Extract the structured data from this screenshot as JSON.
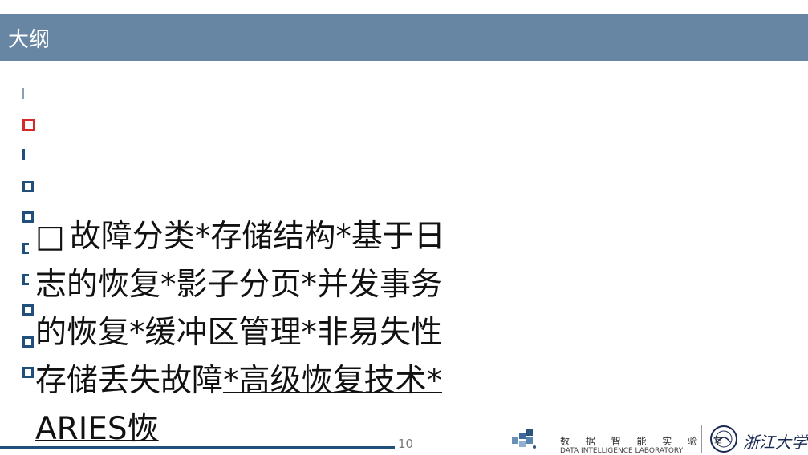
{
  "slide": {
    "title": "大纲",
    "lead_symbol": "□",
    "body_lines": [
      "故障分类*存储结构*基",
      "于日志的恢复*影子分页*",
      "并发事务的恢复*缓冲区管",
      "理*非易失性存储丢失故障",
      "*高级恢复技术*ARIES恢"
    ],
    "page_number": "10",
    "footer": {
      "lab_name_cn": "数 据 智 能 实 验 室",
      "lab_name_en": "DATA INTELLIGENCE LABORATORY",
      "university_name": "浙江大学"
    },
    "colors": {
      "title_bar": "#6786a3",
      "bullet_accent": "#d62a2a",
      "bullet": "#1f4f7a"
    }
  }
}
